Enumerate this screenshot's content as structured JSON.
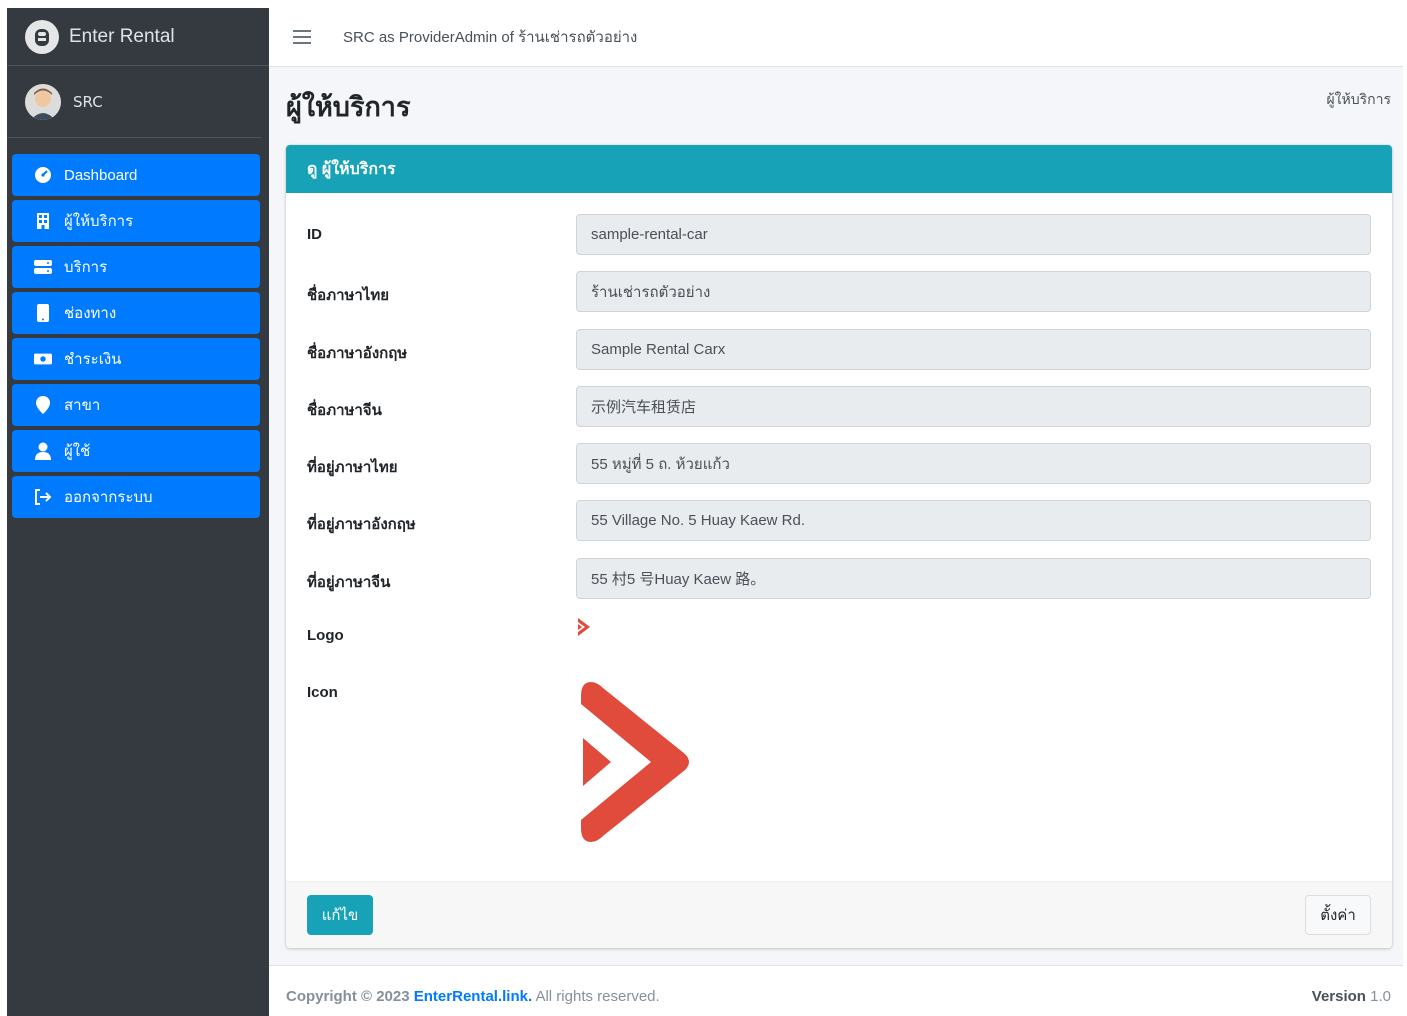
{
  "brand": {
    "name": "Enter Rental"
  },
  "user": {
    "name": "SRC"
  },
  "sidebar": {
    "items": [
      {
        "label": "Dashboard",
        "icon": "dashboard-icon"
      },
      {
        "label": "ผู้ให้บริการ",
        "icon": "building-icon"
      },
      {
        "label": "บริการ",
        "icon": "server-icon"
      },
      {
        "label": "ช่องทาง",
        "icon": "mobile-icon"
      },
      {
        "label": "ชำระเงิน",
        "icon": "money-icon"
      },
      {
        "label": "สาขา",
        "icon": "map-marker-icon"
      },
      {
        "label": "ผู้ใช้",
        "icon": "user-icon"
      },
      {
        "label": "ออกจากระบบ",
        "icon": "logout-icon"
      }
    ]
  },
  "topbar": {
    "text": "SRC as ProviderAdmin of ร้านเช่ารถตัวอย่าง"
  },
  "page": {
    "title": "ผู้ให้บริการ",
    "breadcrumb": "ผู้ให้บริการ"
  },
  "card": {
    "title": "ดู ผู้ให้บริการ",
    "fields": [
      {
        "label": "ID",
        "value": "sample-rental-car"
      },
      {
        "label": "ชื่อภาษาไทย",
        "value": "ร้านเช่ารถตัวอย่าง"
      },
      {
        "label": "ชื่อภาษาอังกฤษ",
        "value": "Sample Rental Carx"
      },
      {
        "label": "ชื่อภาษาจีน",
        "value": "示例汽车租赁店"
      },
      {
        "label": "ที่อยู่ภาษาไทย",
        "value": "55 หมู่ที่ 5 ถ. ห้วยแก้ว"
      },
      {
        "label": "ที่อยู่ภาษาอังกฤษ",
        "value": "55 Village No. 5 Huay Kaew Rd."
      },
      {
        "label": "ที่อยู่ภาษาจีน",
        "value": "55 村5 号Huay Kaew 路。"
      }
    ],
    "logo_label": "Logo",
    "icon_label": "Icon",
    "edit_button": "แก้ไข",
    "settings_button": "ตั้งค่า"
  },
  "footer": {
    "copyright": "Copyright © 2023",
    "link": "EnterRental.link.",
    "rights": "All rights reserved.",
    "version_label": "Version",
    "version": "1.0"
  },
  "colors": {
    "sidebar_bg": "#343a40",
    "nav_primary": "#007bff",
    "card_header": "#17a2b8",
    "logo_red": "#e04b3c"
  }
}
